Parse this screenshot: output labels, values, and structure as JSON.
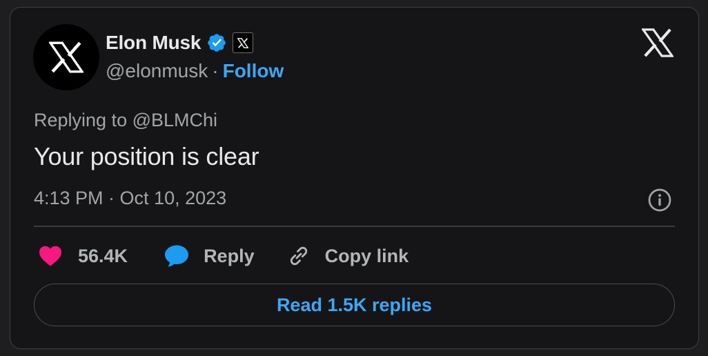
{
  "author": {
    "name": "Elon Musk",
    "handle": "@elonmusk",
    "separator": "·",
    "follow_label": "Follow"
  },
  "replying_to": "Replying to @BLMChi",
  "tweet_text": "Your position is clear",
  "timestamp": "4:13 PM · Oct 10, 2023",
  "actions": {
    "likes": "56.4K",
    "reply_label": "Reply",
    "copy_label": "Copy link"
  },
  "read_replies_label": "Read 1.5K replies",
  "colors": {
    "accent": "#3ea6f5",
    "like": "#f91880",
    "verified": "#1d9bf0",
    "reply_icon": "#1d9bf0"
  },
  "icons": [
    "x-logo-icon",
    "verified-badge-icon",
    "affiliate-x-icon",
    "heart-icon",
    "reply-bubble-icon",
    "link-icon",
    "info-icon"
  ]
}
